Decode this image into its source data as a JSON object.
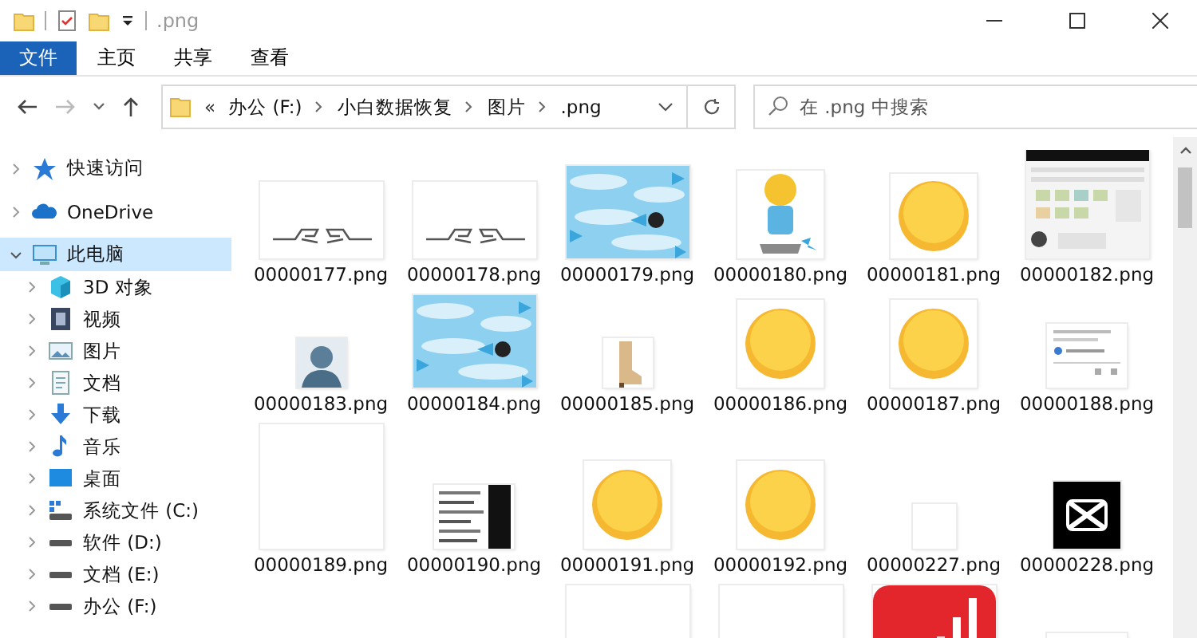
{
  "window": {
    "title": ".png"
  },
  "ribbon": {
    "file_menu": "文件",
    "tabs": [
      {
        "label": "主页"
      },
      {
        "label": "共享"
      },
      {
        "label": "查看"
      }
    ]
  },
  "nav_buttons": [
    {
      "kind": "back",
      "disabled": false
    },
    {
      "kind": "forward",
      "disabled": true
    },
    {
      "kind": "recent",
      "disabled": false
    },
    {
      "kind": "up",
      "disabled": false
    }
  ],
  "address_bar": {
    "overflow": "«",
    "path": [
      "办公 (F:)",
      "小白数据恢复",
      "图片",
      ".png"
    ]
  },
  "search": {
    "placeholder": "在 .png 中搜索"
  },
  "sidebar": {
    "items": [
      {
        "label": "快速访问",
        "kind": "star",
        "expanded": false,
        "selected": false
      },
      {
        "label": "OneDrive",
        "kind": "cloud",
        "expanded": false,
        "selected": false
      },
      {
        "label": "此电脑",
        "kind": "pc",
        "expanded": true,
        "selected": true,
        "children": [
          {
            "label": "3D 对象",
            "kind": "cube",
            "expanded": false,
            "selected": false
          },
          {
            "label": "视频",
            "kind": "video",
            "expanded": false,
            "selected": false
          },
          {
            "label": "图片",
            "kind": "pictures",
            "expanded": false,
            "selected": false
          },
          {
            "label": "文档",
            "kind": "docs",
            "expanded": false,
            "selected": false
          },
          {
            "label": "下载",
            "kind": "download",
            "expanded": false,
            "selected": false
          },
          {
            "label": "音乐",
            "kind": "music",
            "expanded": false,
            "selected": false
          },
          {
            "label": "桌面",
            "kind": "desktop",
            "expanded": false,
            "selected": false
          },
          {
            "label": "系统文件 (C:)",
            "kind": "sysdrive",
            "expanded": false,
            "selected": false
          },
          {
            "label": "软件 (D:)",
            "kind": "drive",
            "expanded": false,
            "selected": false
          },
          {
            "label": "文档 (E:)",
            "kind": "drive",
            "expanded": false,
            "selected": false
          },
          {
            "label": "办公 (F:)",
            "kind": "drive",
            "expanded": false,
            "selected": false
          }
        ]
      }
    ]
  },
  "files": [
    {
      "name": "00000177.png",
      "kind": "picture"
    },
    {
      "name": "00000178.png",
      "kind": "picture"
    },
    {
      "name": "00000179.png",
      "kind": "picture"
    },
    {
      "name": "00000180.png",
      "kind": "picture"
    },
    {
      "name": "00000181.png",
      "kind": "picture"
    },
    {
      "name": "00000182.png",
      "kind": "picture"
    },
    {
      "name": "00000183.png",
      "kind": "picture"
    },
    {
      "name": "00000184.png",
      "kind": "picture"
    },
    {
      "name": "00000185.png",
      "kind": "picture"
    },
    {
      "name": "00000186.png",
      "kind": "picture"
    },
    {
      "name": "00000187.png",
      "kind": "picture"
    },
    {
      "name": "00000188.png",
      "kind": "picture"
    },
    {
      "name": "00000189.png",
      "kind": "picture"
    },
    {
      "name": "00000190.png",
      "kind": "picture"
    },
    {
      "name": "00000191.png",
      "kind": "picture"
    },
    {
      "name": "00000192.png",
      "kind": "picture"
    },
    {
      "name": "00000227.png",
      "kind": "picture"
    },
    {
      "name": "00000228.png",
      "kind": "picture"
    },
    {
      "kind": "picture"
    },
    {
      "kind": "picture"
    },
    {
      "kind": "picture"
    },
    {
      "kind": "picture"
    }
  ]
}
